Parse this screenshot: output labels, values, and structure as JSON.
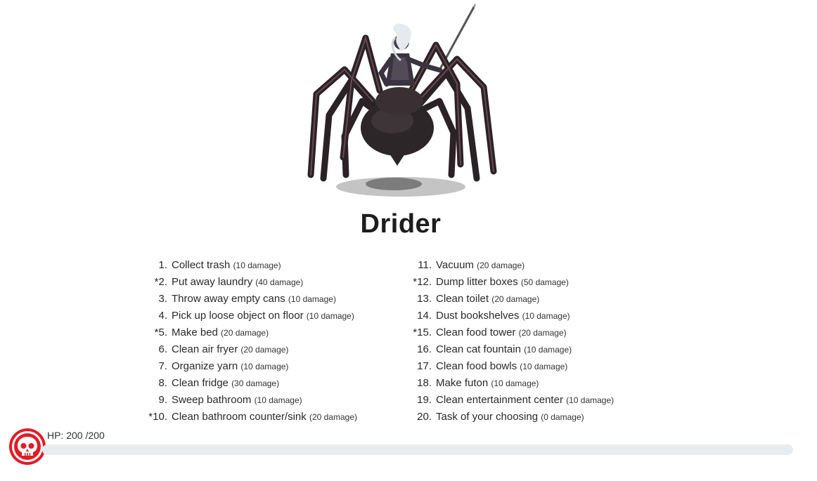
{
  "monster": {
    "name": "Drider",
    "image_icon": "drider-illustration"
  },
  "tasks_left": [
    {
      "num": "1.",
      "label": "Collect trash",
      "damage": "(10 damage)"
    },
    {
      "num": "*2.",
      "label": "Put away laundry",
      "damage": "(40 damage)"
    },
    {
      "num": "3.",
      "label": "Throw away empty cans",
      "damage": "(10 damage)"
    },
    {
      "num": "4.",
      "label": "Pick up loose object on floor",
      "damage": "(10 damage)"
    },
    {
      "num": "*5.",
      "label": "Make bed",
      "damage": "(20 damage)"
    },
    {
      "num": "6.",
      "label": "Clean air fryer",
      "damage": "(20 damage)"
    },
    {
      "num": "7.",
      "label": "Organize yarn",
      "damage": "(10 damage)"
    },
    {
      "num": "8.",
      "label": "Clean fridge",
      "damage": "(30 damage)"
    },
    {
      "num": "9.",
      "label": "Sweep bathroom",
      "damage": "(10 damage)"
    },
    {
      "num": "*10.",
      "label": "Clean bathroom counter/sink",
      "damage": "(20 damage)"
    }
  ],
  "tasks_right": [
    {
      "num": "11.",
      "label": "Vacuum",
      "damage": "(20 damage)"
    },
    {
      "num": "*12.",
      "label": "Dump litter boxes",
      "damage": "(50 damage)"
    },
    {
      "num": "13.",
      "label": "Clean toilet",
      "damage": "(20 damage)"
    },
    {
      "num": "14.",
      "label": "Dust bookshelves",
      "damage": "(10 damage)"
    },
    {
      "num": "*15.",
      "label": "Clean food tower",
      "damage": "(20 damage)"
    },
    {
      "num": "16.",
      "label": "Clean cat fountain",
      "damage": "(10 damage)"
    },
    {
      "num": "17.",
      "label": "Clean food bowls",
      "damage": "(10 damage)"
    },
    {
      "num": "18.",
      "label": "Make futon",
      "damage": "(10 damage)"
    },
    {
      "num": "19.",
      "label": "Clean entertainment center",
      "damage": "(10 damage)"
    },
    {
      "num": "20.",
      "label": "Task of your choosing",
      "damage": "(0 damage)"
    }
  ],
  "hp": {
    "label": "HP: 200 /200",
    "current": 200,
    "max": 200,
    "icon": "skull-icon",
    "badge_color": "#e31b23",
    "track_color": "#e9ecef"
  }
}
